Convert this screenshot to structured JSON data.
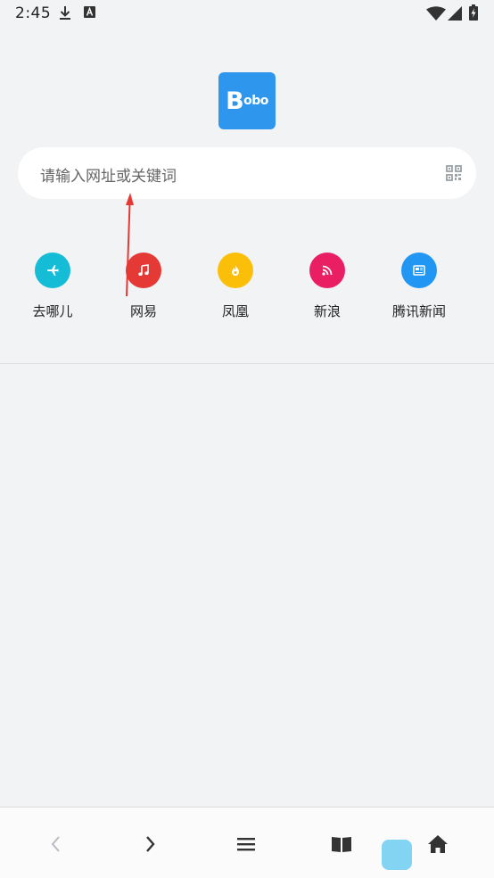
{
  "status_bar": {
    "time": "2:45",
    "icons": [
      "download-icon",
      "font-a-icon",
      "wifi-icon",
      "signal-icon",
      "battery-icon"
    ]
  },
  "logo": {
    "big_letter": "B",
    "small_letters": "obo",
    "color": "#2f96ee"
  },
  "search": {
    "placeholder": "请输入网址或关键词",
    "qr_icon": "qr-scan-icon"
  },
  "shortcuts": [
    {
      "label": "去哪儿",
      "icon": "airplane-icon",
      "color": "#14bcd6"
    },
    {
      "label": "网易",
      "icon": "music-note-icon",
      "color": "#e53935"
    },
    {
      "label": "凤凰",
      "icon": "flame-icon",
      "color": "#fbbf0a"
    },
    {
      "label": "新浪",
      "icon": "rss-icon",
      "color": "#e91e63"
    },
    {
      "label": "腾讯新闻",
      "icon": "newspaper-icon",
      "color": "#2196f3"
    }
  ],
  "bottom_nav": {
    "items": [
      "back-icon",
      "forward-icon",
      "menu-icon",
      "bookmarks-icon",
      "home-icon"
    ]
  },
  "annotation": {
    "color": "#e53935"
  }
}
